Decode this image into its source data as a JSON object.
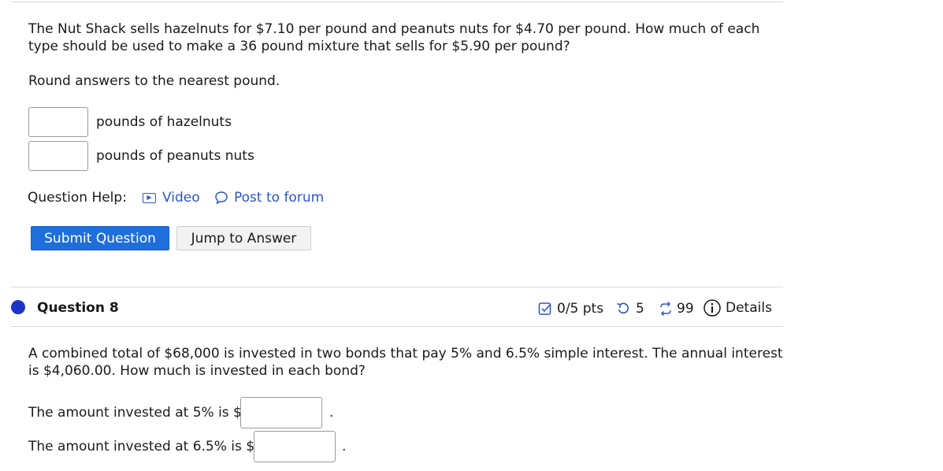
{
  "problem7": {
    "text": "The Nut Shack sells hazelnuts for $7.10 per pound and peanuts nuts for $4.70 per pound. How much of each type should be used to make a 36 pound mixture that sells for $5.90 per pound?",
    "instruction": "Round answers to the nearest pound.",
    "answer1_label": "pounds of hazelnuts",
    "answer2_label": "pounds of peanuts nuts",
    "help_label": "Question Help:",
    "video_link": "Video",
    "forum_link": "Post to forum",
    "submit_button": "Submit Question",
    "jump_button": "Jump to Answer"
  },
  "question8": {
    "title": "Question 8",
    "points": "0/5 pts",
    "retries": "5",
    "attempts": "99",
    "details": "Details",
    "text": "A combined total of $68,000 is invested in two bonds that pay 5% and 6.5% simple interest. The annual interest is $4,060.00. How much is invested in each bond?",
    "label1": "The amount invested at 5% is $",
    "label2": "The amount invested at 6.5% is $",
    "period": "."
  },
  "icons": {
    "video": "play-box-icon",
    "forum": "speech-bubble-icon",
    "points": "checkbox-icon",
    "retries": "retry-arrow-icon",
    "attempts": "cycle-arrows-icon",
    "details": "info-circle-icon",
    "status": "status-dot-icon"
  },
  "colors": {
    "link": "#2e55c9",
    "primary_button": "#1e6fdc",
    "status_dot": "#1d35c7"
  }
}
